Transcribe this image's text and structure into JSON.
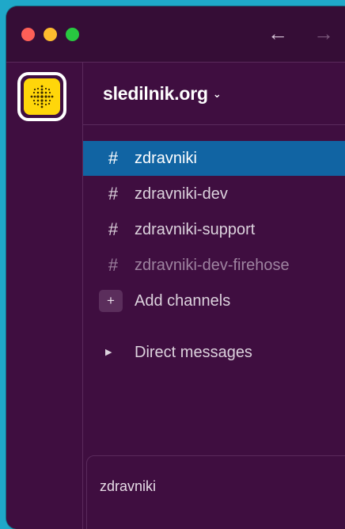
{
  "workspace": {
    "name": "sledilnik.org",
    "icon": "sledilnik-logo-icon",
    "icon_color": "#ffd60a"
  },
  "titlebar": {
    "back_icon": "arrow-left-icon",
    "forward_icon": "arrow-right-icon"
  },
  "channels": [
    {
      "hash": "#",
      "label": "zdravniki",
      "state": "active"
    },
    {
      "hash": "#",
      "label": "zdravniki-dev",
      "state": "normal"
    },
    {
      "hash": "#",
      "label": "zdravniki-support",
      "state": "normal"
    },
    {
      "hash": "#",
      "label": "zdravniki-dev-firehose",
      "state": "muted"
    }
  ],
  "add_channels": {
    "icon": "+",
    "label": "Add channels"
  },
  "direct_messages": {
    "label": "Direct messages"
  },
  "composer": {
    "text": "zdravniki"
  },
  "colors": {
    "sidebar": "#3f0e40",
    "active": "#1164a3",
    "desktop": "#1fa8c9"
  }
}
